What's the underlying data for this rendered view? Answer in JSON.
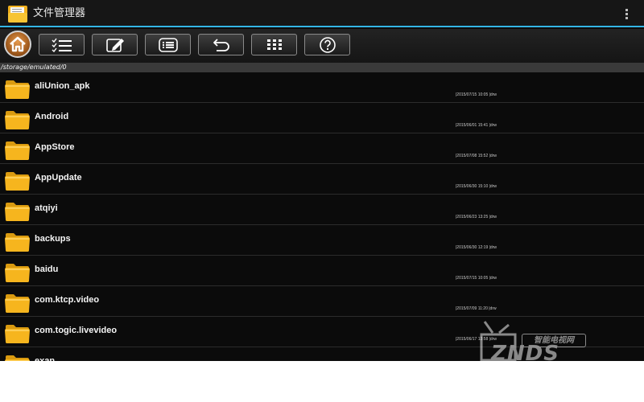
{
  "titlebar": {
    "title": "文件管理器",
    "app_icon": "file-manager-folder-icon",
    "menu_icon": "overflow-menu-icon"
  },
  "toolbar": {
    "buttons": [
      {
        "name": "home",
        "icon": "home-icon"
      },
      {
        "name": "multi-select",
        "icon": "checklist-icon"
      },
      {
        "name": "edit",
        "icon": "edit-icon"
      },
      {
        "name": "list-view",
        "icon": "list-icon"
      },
      {
        "name": "back",
        "icon": "undo-arrow-icon"
      },
      {
        "name": "grid-view",
        "icon": "grid-icon"
      },
      {
        "name": "help",
        "icon": "help-icon"
      }
    ]
  },
  "path": "/storage/emulated/0",
  "files": [
    {
      "name": "aliUnion_apk",
      "meta": "|2015/07/15 10:05 |drw"
    },
    {
      "name": "Android",
      "meta": "|2015/06/01 15:41 |drw"
    },
    {
      "name": "AppStore",
      "meta": "|2015/07/08 15:52 |drw"
    },
    {
      "name": "AppUpdate",
      "meta": "|2015/06/30 15:10 |drw"
    },
    {
      "name": "atqiyi",
      "meta": "|2015/06/23 13:25 |drw"
    },
    {
      "name": "backups",
      "meta": "|2015/06/30 12:19 |drw"
    },
    {
      "name": "baidu",
      "meta": "|2015/07/15 10:05 |drw"
    },
    {
      "name": "com.ktcp.video",
      "meta": "|2015/07/09 11:20 |drw"
    },
    {
      "name": "com.togic.livevideo",
      "meta": "|2015/06/17 13:58 |drw"
    },
    {
      "name": "exan",
      "meta": ""
    }
  ],
  "watermark": {
    "cn": "智能电视网",
    "en": "ZNDS"
  },
  "colors": {
    "accent": "#33b5e5",
    "folder": "#f6b51e",
    "home_button": "#c97a33"
  }
}
